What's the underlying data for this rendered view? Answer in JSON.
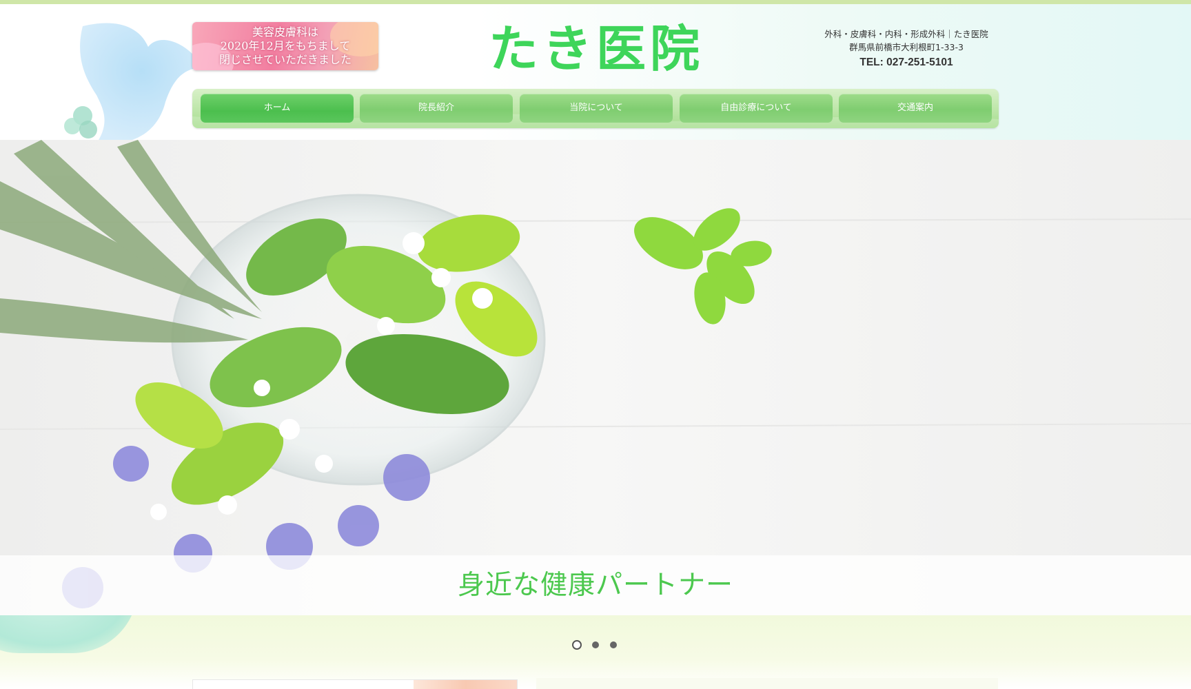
{
  "banner": {
    "lines": [
      "美容皮膚科は",
      "2020年12月をもちまして",
      "閉じさせていただきました"
    ]
  },
  "logo": {
    "text": "たき医院"
  },
  "info": {
    "departments": "外科・皮膚科・内科・形成外科｜たき医院",
    "address": "群馬県前橋市大利根町1-33-3",
    "tel": "TEL: 027-251-5101"
  },
  "nav": {
    "items": [
      {
        "label": "ホーム",
        "active": true
      },
      {
        "label": "院長紹介"
      },
      {
        "label": "当院について"
      },
      {
        "label": "自由診療について"
      },
      {
        "label": "交通案内"
      }
    ]
  },
  "hero": {
    "caption": "身近な健康パートナー",
    "slides": {
      "count": 3,
      "active": 1
    }
  },
  "colors": {
    "accent_green": "#3ed55a",
    "nav_green": "#7fcd70",
    "caption_green": "#4cc84e"
  }
}
